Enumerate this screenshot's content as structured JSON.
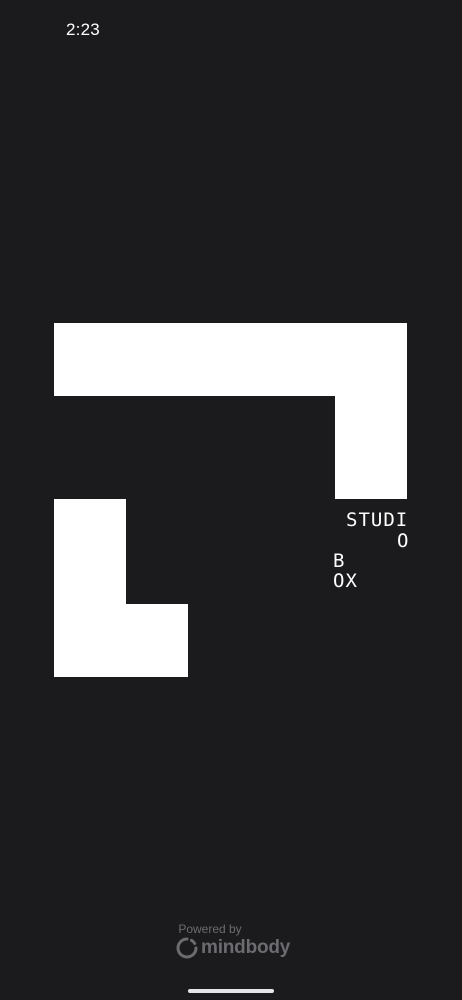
{
  "status_bar": {
    "time": "2:23"
  },
  "brand": {
    "line1": "STUDI",
    "line2": "O",
    "line3": "B",
    "line4": "OX",
    "shape_color": "#ffffff"
  },
  "footer": {
    "powered_by": "Powered by",
    "provider": "mindbody"
  },
  "colors": {
    "background": "#1b1a1c",
    "footer_text": "#6c6b70",
    "home_indicator": "#e6e6e6"
  }
}
